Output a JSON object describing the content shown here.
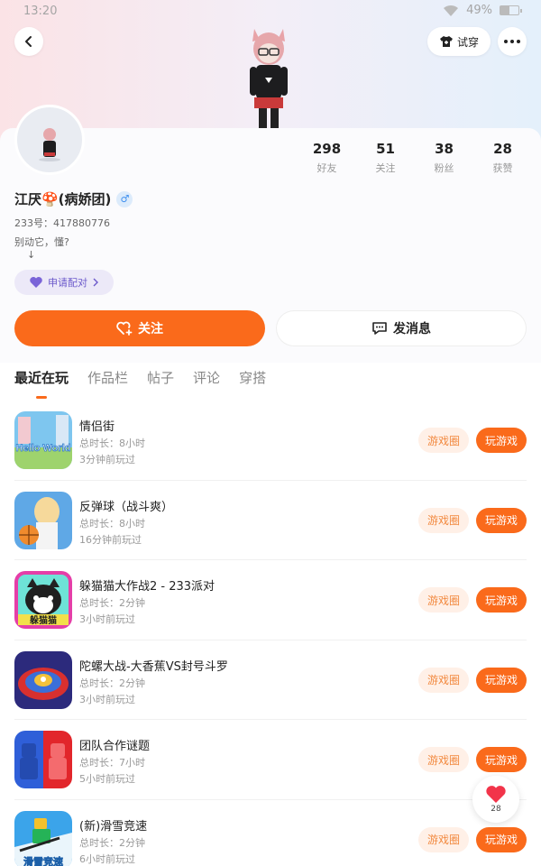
{
  "status_bar": {
    "time": "13:20",
    "battery": "49%",
    "battery_level": 0.49
  },
  "header": {
    "try_on_label": "试穿"
  },
  "profile": {
    "name": "江厌🍄(病娇团)",
    "gender_symbol": "♂",
    "uid": "233号：417880776",
    "bio": "别动它，懂?\n    ↓",
    "pair_label": "申请配对",
    "stats": [
      {
        "value": "298",
        "label": "好友"
      },
      {
        "value": "51",
        "label": "关注"
      },
      {
        "value": "38",
        "label": "粉丝"
      },
      {
        "value": "28",
        "label": "获赞"
      }
    ]
  },
  "actions": {
    "follow_label": "关注",
    "message_label": "发消息"
  },
  "tabs": [
    "最近在玩",
    "作品栏",
    "帖子",
    "评论",
    "穿搭"
  ],
  "games": [
    {
      "name": "情侣街",
      "duration": "总时长：8小时",
      "last_played": "3分钟前玩过",
      "circle_label": "游戏圈",
      "play_label": "玩游戏",
      "icon": "hello-world-icon",
      "icon_text": "Hello World"
    },
    {
      "name": "反弹球（战斗爽）",
      "duration": "总时长：8小时",
      "last_played": "16分钟前玩过",
      "circle_label": "游戏圈",
      "play_label": "玩游戏",
      "icon": "anime-ball-icon"
    },
    {
      "name": "躲猫猫大作战2 - 233派对",
      "duration": "总时长：2分钟",
      "last_played": "3小时前玩过",
      "circle_label": "游戏圈",
      "play_label": "玩游戏",
      "icon": "cat-icon",
      "icon_text": "躲猫猫"
    },
    {
      "name": "陀螺大战-大香蕉VS封号斗罗",
      "duration": "总时长：2分钟",
      "last_played": "3小时前玩过",
      "circle_label": "游戏圈",
      "play_label": "玩游戏",
      "icon": "spinning-top-icon"
    },
    {
      "name": "团队合作谜题",
      "duration": "总时长：7小时",
      "last_played": "5小时前玩过",
      "circle_label": "游戏圈",
      "play_label": "玩游戏",
      "icon": "red-blue-team-icon"
    },
    {
      "name": "(新)滑雪竞速",
      "duration": "总时长：2分钟",
      "last_played": "6小时前玩过",
      "circle_label": "游戏圈",
      "play_label": "玩游戏",
      "icon": "ski-race-icon",
      "icon_text": "滑雪竞速"
    }
  ],
  "like_float": {
    "count": "28"
  },
  "colors": {
    "accent": "#fa6a1b",
    "circle_bg": "#fff0e7",
    "circle_text": "#f2893f",
    "pair_bg": "#ece9f8",
    "pair_text": "#6c5acb"
  }
}
